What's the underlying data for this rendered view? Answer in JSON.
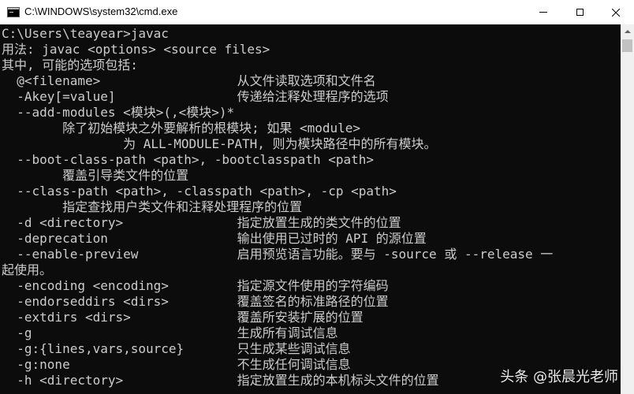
{
  "window": {
    "title": "C:\\WINDOWS\\system32\\cmd.exe",
    "icon": "console-icon",
    "controls": {
      "minimize": "minimize-icon",
      "maximize": "maximize-icon",
      "close": "close-icon"
    }
  },
  "console": {
    "foreground": "#cccccc",
    "background": "#0c0c0c",
    "lines": [
      "C:\\Users\\teayear>javac",
      "用法: javac <options> <source files>",
      "其中, 可能的选项包括:",
      "  @<filename>                  从文件读取选项和文件名",
      "  -Akey[=value]                传递给注释处理程序的选项",
      "  --add-modules <模块>(,<模块>)*",
      "        除了初始模块之外要解析的根模块; 如果 <module>",
      "                为 ALL-MODULE-PATH, 则为模块路径中的所有模块。",
      "  --boot-class-path <path>, -bootclasspath <path>",
      "        覆盖引导类文件的位置",
      "  --class-path <path>, -classpath <path>, -cp <path>",
      "        指定查找用户类文件和注释处理程序的位置",
      "  -d <directory>               指定放置生成的类文件的位置",
      "  -deprecation                 输出使用已过时的 API 的源位置",
      "  --enable-preview             启用预览语言功能。要与 -source 或 --release 一",
      "起使用。",
      "  -encoding <encoding>         指定源文件使用的字符编码",
      "  -endorseddirs <dirs>         覆盖签名的标准路径的位置",
      "  -extdirs <dirs>              覆盖所安装扩展的位置",
      "  -g                           生成所有调试信息",
      "  -g:{lines,vars,source}       只生成某些调试信息",
      "  -g:none                      不生成任何调试信息",
      "  -h <directory>               指定放置生成的本机标头文件的位置"
    ]
  },
  "watermark": "头条 @张晨光老师"
}
